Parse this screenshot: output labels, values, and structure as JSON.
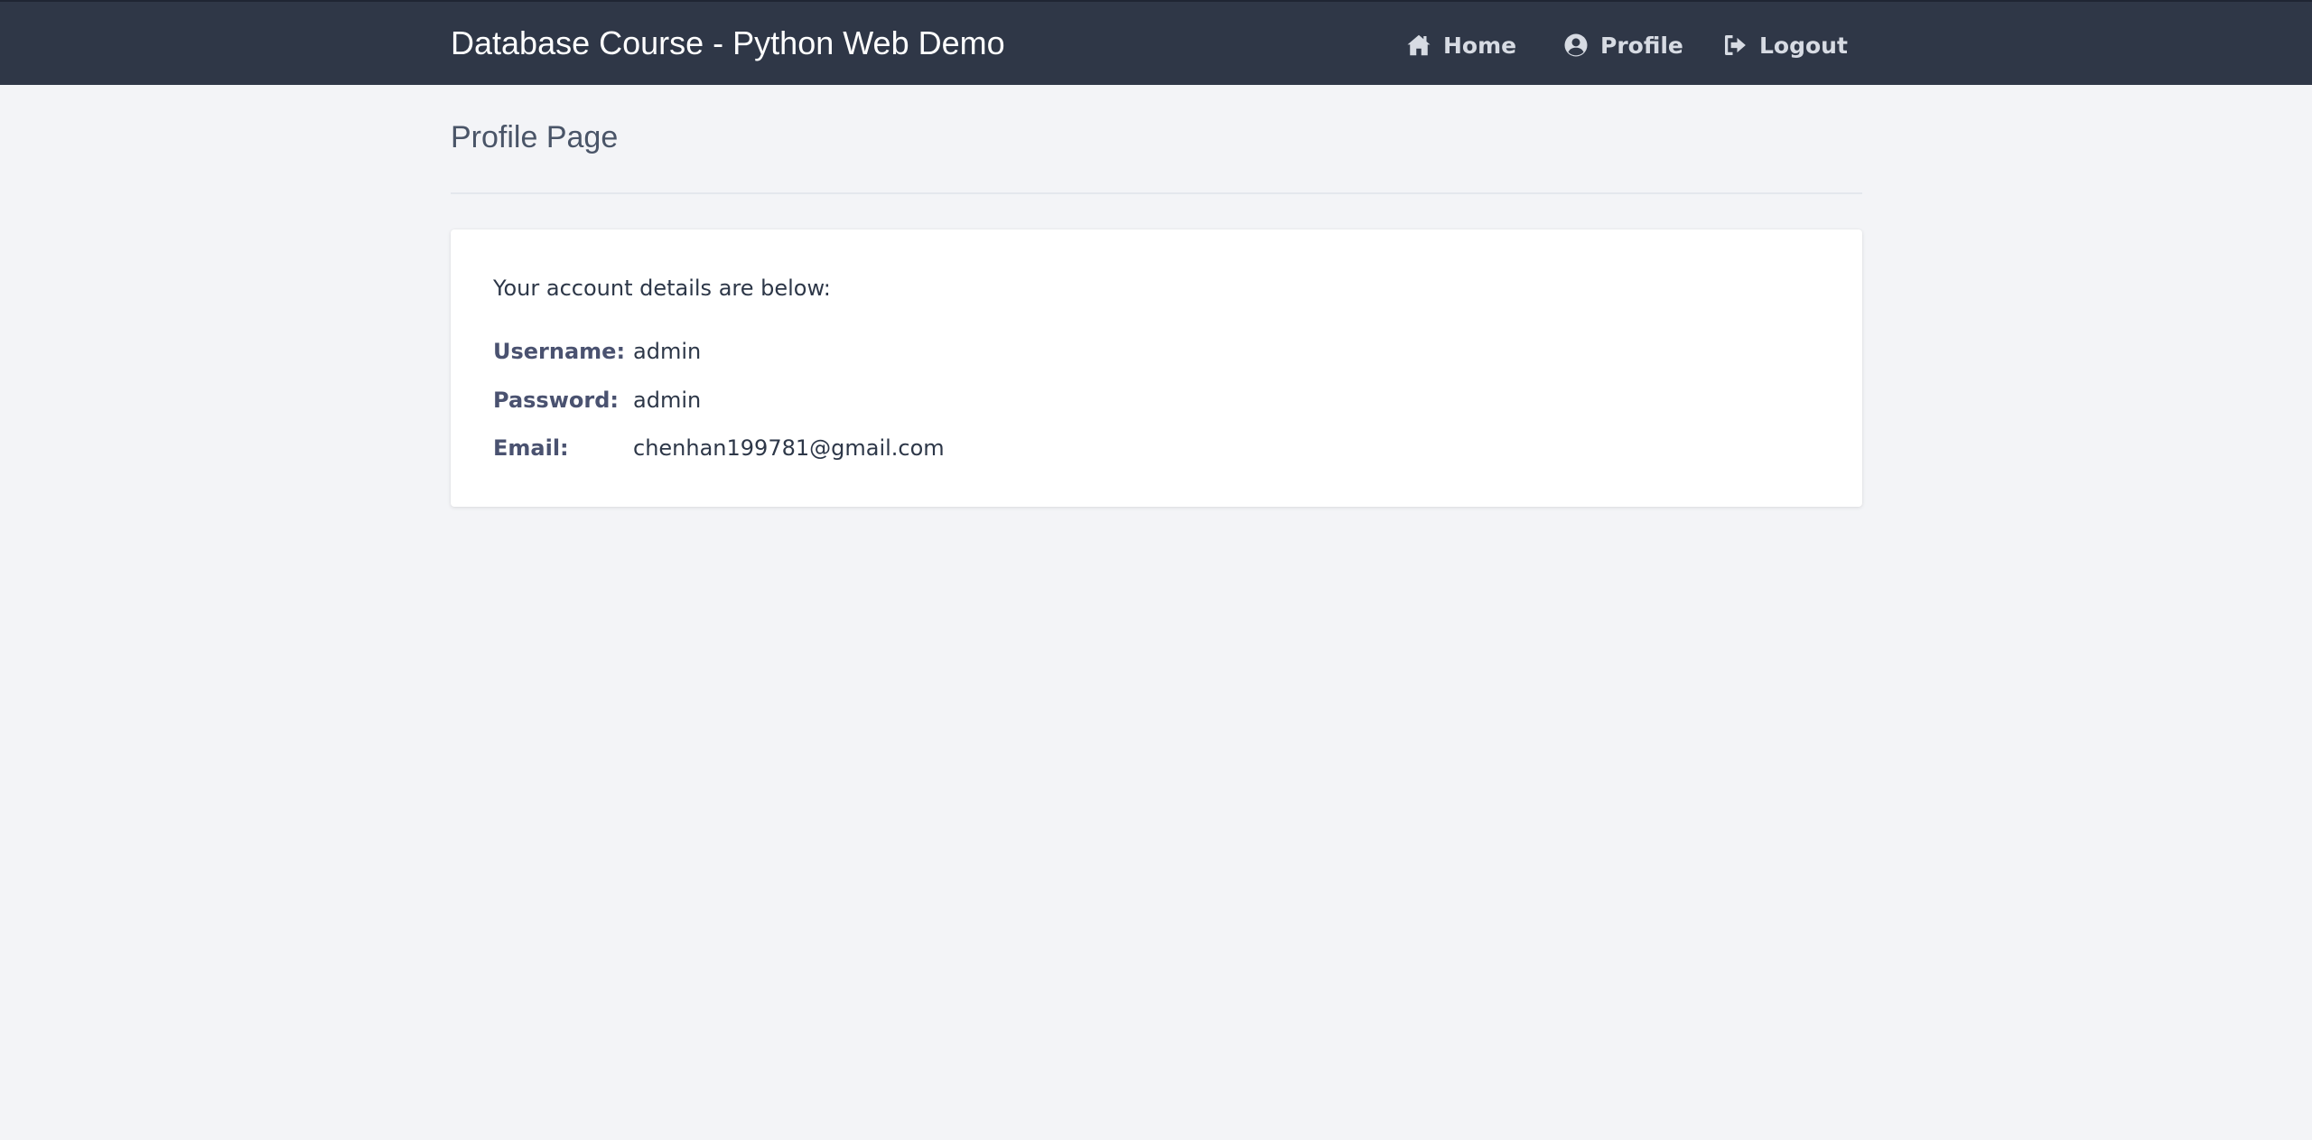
{
  "navbar": {
    "brand": "Database Course - Python Web Demo",
    "items": [
      {
        "label": "Home",
        "icon": "home-icon"
      },
      {
        "label": "Profile",
        "icon": "user-circle-icon"
      },
      {
        "label": "Logout",
        "icon": "logout-icon"
      }
    ]
  },
  "page": {
    "title": "Profile Page"
  },
  "card": {
    "intro": "Your account details are below:",
    "fields": [
      {
        "label": "Username:",
        "value": "admin"
      },
      {
        "label": "Password:",
        "value": "admin"
      },
      {
        "label": "Email:",
        "value": "chenhan199781@gmail.com"
      }
    ]
  },
  "colors": {
    "navbar_bg": "#2f3747",
    "page_bg": "#f3f4f7",
    "nav_text": "#d7dbe3",
    "label_text": "#4a5270"
  }
}
